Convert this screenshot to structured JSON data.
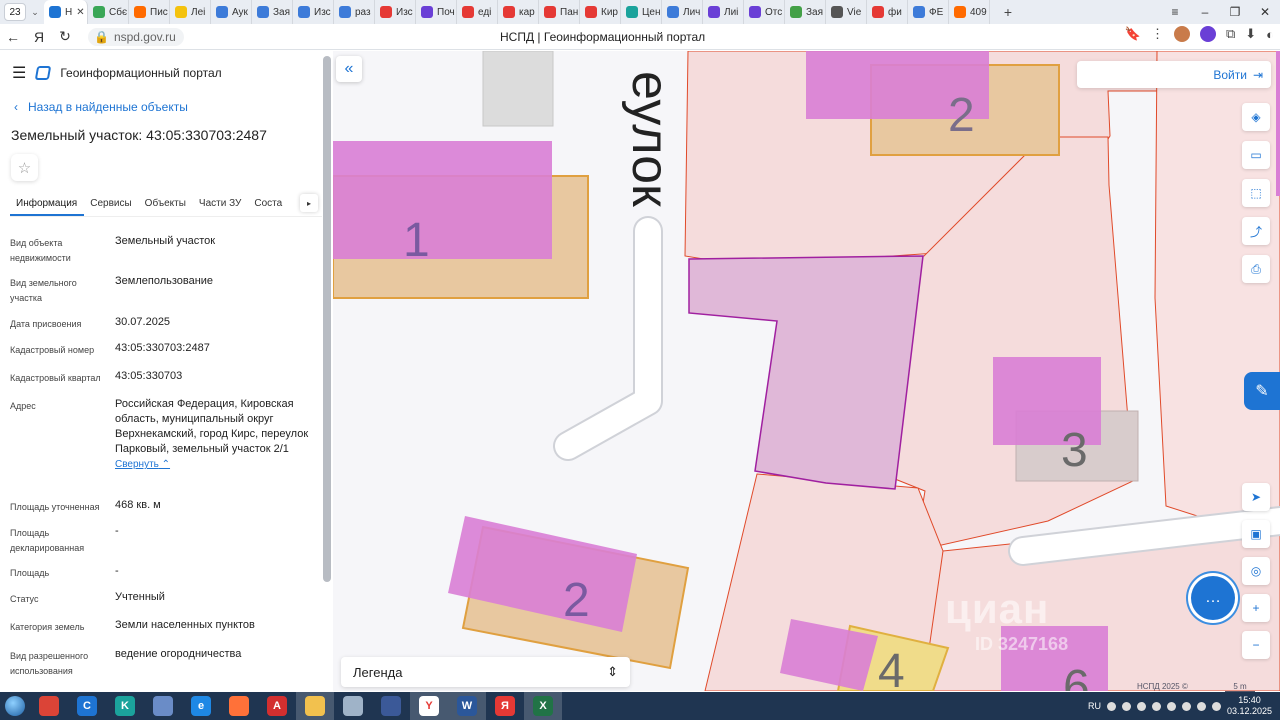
{
  "browser": {
    "tab_count": "23",
    "tabs": [
      {
        "label": "Н",
        "color": "#1e74d3",
        "active": true
      },
      {
        "label": "Сбє",
        "color": "#3aa757"
      },
      {
        "label": "Пис",
        "color": "#ff6a00"
      },
      {
        "label": "Леі",
        "color": "#f4c20d"
      },
      {
        "label": "Аук",
        "color": "#3d7bd9"
      },
      {
        "label": "Зая",
        "color": "#3d7bd9"
      },
      {
        "label": "Изс",
        "color": "#3d7bd9"
      },
      {
        "label": "раз",
        "color": "#3d7bd9"
      },
      {
        "label": "Изс",
        "color": "#e53935"
      },
      {
        "label": "Поч",
        "color": "#6a3fd6"
      },
      {
        "label": "еді",
        "color": "#e53935"
      },
      {
        "label": "кар",
        "color": "#e53935"
      },
      {
        "label": "Пан",
        "color": "#e53935"
      },
      {
        "label": "Кир",
        "color": "#e53935"
      },
      {
        "label": "Цен",
        "color": "#1ba39c"
      },
      {
        "label": "Лич",
        "color": "#3d7bd9"
      },
      {
        "label": "Лиі",
        "color": "#6a3fd6"
      },
      {
        "label": "Отс",
        "color": "#6a3fd6"
      },
      {
        "label": "Зая",
        "color": "#43a047"
      },
      {
        "label": "Vie",
        "color": "#555555"
      },
      {
        "label": "фи",
        "color": "#e53935"
      },
      {
        "label": "ФЕ",
        "color": "#3d7bd9"
      },
      {
        "label": "409",
        "color": "#ff6a00"
      }
    ],
    "url": "nspd.gov.ru",
    "page_title": "НСПД | Геоинформационный портал"
  },
  "panel": {
    "portal_name": "Геоинформационный портал",
    "back_label": "Назад в найденные объекты",
    "title": "Земельный участок: 43:05:330703:2487",
    "tabs": [
      "Информация",
      "Сервисы",
      "Объекты",
      "Части ЗУ",
      "Соста"
    ],
    "props": [
      {
        "k": "Вид объекта недвижимости",
        "v": "Земельный участок"
      },
      {
        "k": "Вид земельного участка",
        "v": "Землепользование"
      },
      {
        "k": "Дата присвоения",
        "v": "30.07.2025"
      },
      {
        "k": "Кадастровый номер",
        "v": "43:05:330703:2487"
      },
      {
        "k": "Кадастровый квартал",
        "v": "43:05:330703"
      },
      {
        "k": "Адрес",
        "v": "Российская Федерация, Кировская область, муниципальный округ Верхнекамский, город Кирс, переулок Парковый, земельный участок 2/1"
      },
      {
        "k": "Площадь уточненная",
        "v": "468 кв. м"
      },
      {
        "k": "Площадь декларированная",
        "v": "-"
      },
      {
        "k": "Площадь",
        "v": "-"
      },
      {
        "k": "Статус",
        "v": "Учтенный"
      },
      {
        "k": "Категория земель",
        "v": "Земли населенных пунктов"
      },
      {
        "k": "Вид разрешенного использования",
        "v": "ведение огородничества"
      }
    ],
    "collapse_label": "Свернуть"
  },
  "map": {
    "street_label": "еулок",
    "login_label": "Войти",
    "legend_label": "Легенда",
    "copyright": "НСПД 2025 ©",
    "scale_label": "5 m",
    "watermark": "циан",
    "watermark_id": "ID 3247168",
    "building_numbers": [
      "1",
      "2",
      "2",
      "3",
      "4",
      "6"
    ],
    "colors": {
      "parcel_fill": "#f5dcdc",
      "parcel_line": "#e04a2a",
      "selected_fill": "#e0b8d8",
      "selected_line": "#a020a0",
      "building_fill": "#d97ed5",
      "house_fill": "#e8c8a0",
      "house_line": "#e0a040",
      "road": "#ffffff"
    }
  },
  "taskbar": {
    "lang": "RU",
    "time": "15:40",
    "date": "03.12.2025",
    "apps": [
      {
        "name": "chrome",
        "color": "#db4437",
        "label": "",
        "active": false
      },
      {
        "name": "ccleaner",
        "color": "#1e74d3",
        "label": "C",
        "active": false
      },
      {
        "name": "kaspersky",
        "color": "#1ba39c",
        "label": "K",
        "active": false
      },
      {
        "name": "network",
        "color": "#6a8cc7",
        "label": "",
        "active": false
      },
      {
        "name": "ie",
        "color": "#1e88e5",
        "label": "e",
        "active": false
      },
      {
        "name": "firefox",
        "color": "#ff7139",
        "label": "",
        "active": false
      },
      {
        "name": "acrobat",
        "color": "#d32f2f",
        "label": "A",
        "active": false
      },
      {
        "name": "explorer",
        "color": "#f2c14e",
        "label": "",
        "active": true
      },
      {
        "name": "recycle",
        "color": "#9fb3c8",
        "label": "",
        "active": false
      },
      {
        "name": "save",
        "color": "#3b5998",
        "label": "",
        "active": false
      },
      {
        "name": "yandex-browser",
        "color": "#ffffff",
        "label": "Y",
        "active": true
      },
      {
        "name": "word",
        "color": "#2b579a",
        "label": "W",
        "active": true
      },
      {
        "name": "yandex",
        "color": "#e53935",
        "label": "Я",
        "active": false
      },
      {
        "name": "excel",
        "color": "#217346",
        "label": "X",
        "active": true
      }
    ]
  }
}
